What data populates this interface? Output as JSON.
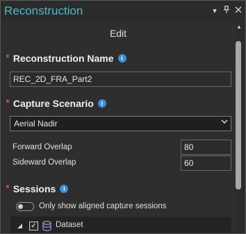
{
  "pane": {
    "title": "Reconstruction",
    "menu_icon": "chevron-down-icon",
    "pin_icon": "pin-icon",
    "close_icon": "close-icon"
  },
  "header": {
    "edit_label": "Edit"
  },
  "reconstruction_name": {
    "label": "Reconstruction Name",
    "required_marker": "*",
    "value": "REC_2D_FRA_Part2"
  },
  "capture_scenario": {
    "label": "Capture Scenario",
    "required_marker": "*",
    "selected": "Aerial Nadir",
    "forward_overlap_label": "Forward Overlap",
    "forward_overlap_value": "80",
    "sideward_overlap_label": "Sideward Overlap",
    "sideward_overlap_value": "60"
  },
  "sessions": {
    "label": "Sessions",
    "required_marker": "*",
    "toggle_label": "Only show aligned capture sessions",
    "toggle_on": false,
    "tree_items": [
      {
        "label": "Dataset",
        "checked": true,
        "expanded": true
      }
    ]
  },
  "colors": {
    "title": "#4fb8c6",
    "required": "#e2683c",
    "info": "#3c8ed8",
    "background": "#2b2b2b"
  }
}
